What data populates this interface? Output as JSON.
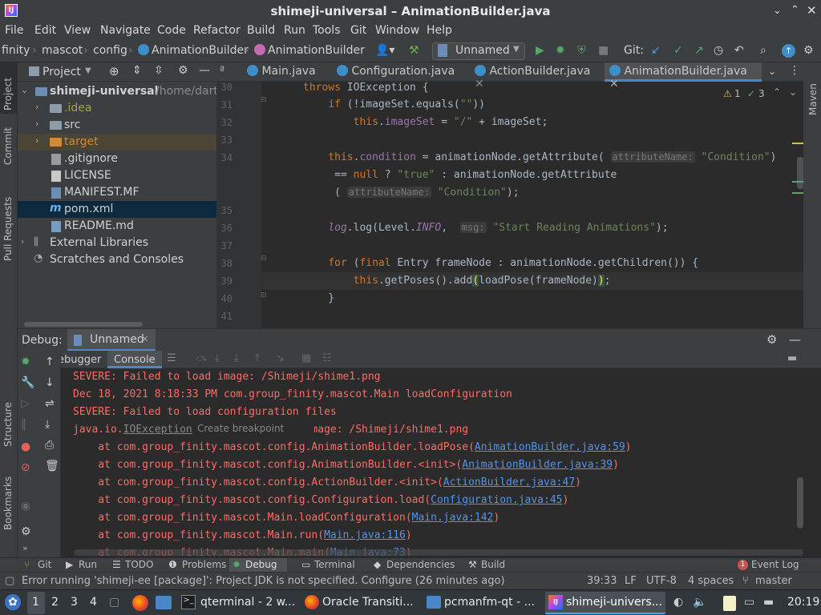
{
  "window": {
    "title": "shimeji-universal – AnimationBuilder.java"
  },
  "menu": [
    "File",
    "Edit",
    "View",
    "Navigate",
    "Code",
    "Refactor",
    "Build",
    "Run",
    "Tools",
    "Git",
    "Window",
    "Help"
  ],
  "breadcrumb": [
    "finity",
    "mascot",
    "config",
    "AnimationBuilder",
    "AnimationBuilder"
  ],
  "toolbar": {
    "run_config": "Unnamed",
    "git_label": "Git:"
  },
  "left_strip": [
    "Project",
    "Commit",
    "Pull Requests",
    "Structure",
    "Bookmarks"
  ],
  "right_strip": [
    "Maven"
  ],
  "project": {
    "title": "Project",
    "tree": [
      {
        "label": "shimeji-universal",
        "suffix": "/home/dartz",
        "depth": 0,
        "kind": "root",
        "open": true
      },
      {
        "label": ".idea",
        "depth": 1,
        "kind": "folder",
        "open": false
      },
      {
        "label": "src",
        "depth": 1,
        "kind": "folder",
        "open": false
      },
      {
        "label": "target",
        "depth": 1,
        "kind": "folder-orange",
        "open": false
      },
      {
        "label": ".gitignore",
        "depth": 1,
        "kind": "file"
      },
      {
        "label": "LICENSE",
        "depth": 1,
        "kind": "file"
      },
      {
        "label": "MANIFEST.MF",
        "depth": 1,
        "kind": "file"
      },
      {
        "label": "pom.xml",
        "depth": 1,
        "kind": "file",
        "selected": true
      },
      {
        "label": "README.md",
        "depth": 1,
        "kind": "file"
      },
      {
        "label": "External Libraries",
        "depth": 0,
        "kind": "lib",
        "open": false
      },
      {
        "label": "Scratches and Consoles",
        "depth": 0,
        "kind": "scratch"
      }
    ]
  },
  "editor": {
    "tabs": [
      {
        "label": "Main.java",
        "active": false
      },
      {
        "label": "Configuration.java",
        "active": false
      },
      {
        "label": "ActionBuilder.java",
        "active": false
      },
      {
        "label": "AnimationBuilder.java",
        "active": true
      }
    ],
    "warnings": "1",
    "checks": "3",
    "line_numbers": [
      "30",
      "31",
      "32",
      "33",
      "34",
      "",
      "",
      "35",
      "36",
      "37",
      "38",
      "39",
      "40",
      "41"
    ]
  },
  "debug": {
    "label": "Debug:",
    "config": "Unnamed",
    "tabs": [
      "Debugger",
      "Console"
    ],
    "tooltip": "Create breakpoint",
    "console": [
      {
        "text": "SEVERE: Failed to load image: /Shimeji/shime1.png"
      },
      {
        "text": "Dec 18, 2021 8:18:33 PM com.group_finity.mascot.Main loadConfiguration"
      },
      {
        "text": "SEVERE: Failed to load configuration files"
      },
      {
        "pre": "java.io.",
        "link_plain": "IOException",
        "post": " : Failed to load image: /Shimeji/shime1.png"
      },
      {
        "pre": "    at com.group_finity.mascot.config.AnimationBuilder.loadPose(",
        "link": "AnimationBuilder.java:59",
        "post": ")"
      },
      {
        "pre": "    at com.group_finity.mascot.config.AnimationBuilder.<init>(",
        "link": "AnimationBuilder.java:39",
        "post": ")"
      },
      {
        "pre": "    at com.group_finity.mascot.config.ActionBuilder.<init>(",
        "link": "ActionBuilder.java:47",
        "post": ")"
      },
      {
        "pre": "    at com.group_finity.mascot.config.Configuration.load(",
        "link": "Configuration.java:45",
        "post": ")"
      },
      {
        "pre": "    at com.group_finity.mascot.Main.loadConfiguration(",
        "link": "Main.java:142",
        "post": ")"
      },
      {
        "pre": "    at com.group_finity.mascot.Main.run(",
        "link": "Main.java:116",
        "post": ")"
      },
      {
        "pre": "    at com.group_finity.mascot.Main.main(",
        "link": "Main.java:73",
        "post": ")"
      }
    ]
  },
  "bottom_tools": [
    "Git",
    "Run",
    "TODO",
    "Problems",
    "Debug",
    "Terminal",
    "Dependencies",
    "Build",
    "Event Log"
  ],
  "event_log_count": "1",
  "status": {
    "message": "Error running 'shimeji-ee [package]': Project JDK is not specified. Configure (26 minutes ago)",
    "position": "39:33",
    "line_sep": "LF",
    "encoding": "UTF-8",
    "indent": "4 spaces",
    "branch": "master"
  },
  "taskbar": {
    "desktops": [
      "1",
      "2",
      "3",
      "4"
    ],
    "items": [
      "qterminal - 2 w...",
      "Oracle Transiti...",
      "pcmanfm-qt - ...",
      "shimeji-univers..."
    ],
    "clock": "20:19"
  }
}
